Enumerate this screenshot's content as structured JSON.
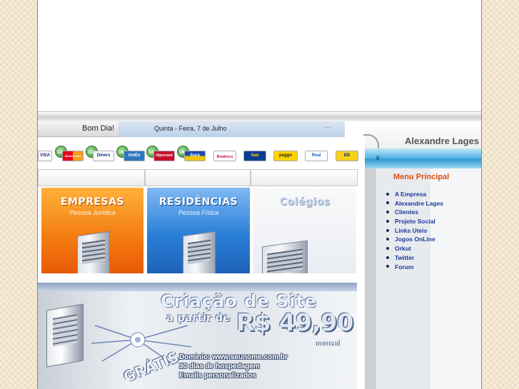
{
  "header": {
    "greeting": "Bom Dia!",
    "date": "Quinta - Feira, 7 de Julho",
    "date_trail": "---"
  },
  "site": {
    "name": "Alexandre Lages",
    "band_text": "6"
  },
  "menu": {
    "title": "Menu Principal",
    "items": [
      "A Empresa",
      "Alexandre Lages",
      "Clientes",
      "Projeto Social",
      "Links Uteis",
      "Jogos OnLine",
      "Orkut",
      "Twitter",
      "Forum"
    ]
  },
  "payments": {
    "cards": [
      {
        "label": "VISA",
        "badge": ""
      },
      {
        "label": "MasterCard",
        "badge": "12x"
      },
      {
        "label": "Diners",
        "badge": "12x"
      },
      {
        "label": "AmEx",
        "badge": "15x"
      },
      {
        "label": "Hipercard",
        "badge": "12x"
      },
      {
        "label": "Aura",
        "badge": "18x"
      },
      {
        "label": "Bradesco",
        "badge": ""
      },
      {
        "label": "Itaú",
        "badge": ""
      },
      {
        "label": "paggo",
        "badge": ""
      },
      {
        "label": "Real",
        "badge": ""
      },
      {
        "label": "BB",
        "badge": ""
      }
    ]
  },
  "tiles": {
    "empresas": {
      "title": "EMPRESAS",
      "subtitle": "Pessoa Jurídica"
    },
    "residencias": {
      "title": "RESIDÊNCIAS",
      "subtitle": "Pessoa Física"
    },
    "colegios": {
      "title": "Colégios"
    }
  },
  "banner": {
    "title": "Criação de Site",
    "from": "a partir de",
    "price": "R$ 49,90",
    "period": "mensal",
    "free": "GRÁTIS",
    "lines": [
      "Dominio: www.seunome.com.br",
      "30 dias de hospedagem",
      "Emails personalizados"
    ]
  },
  "colors": {
    "menu_title": "#e04a10",
    "menu_link": "#1a3a9e",
    "band_blue": "#2f9ad4"
  }
}
